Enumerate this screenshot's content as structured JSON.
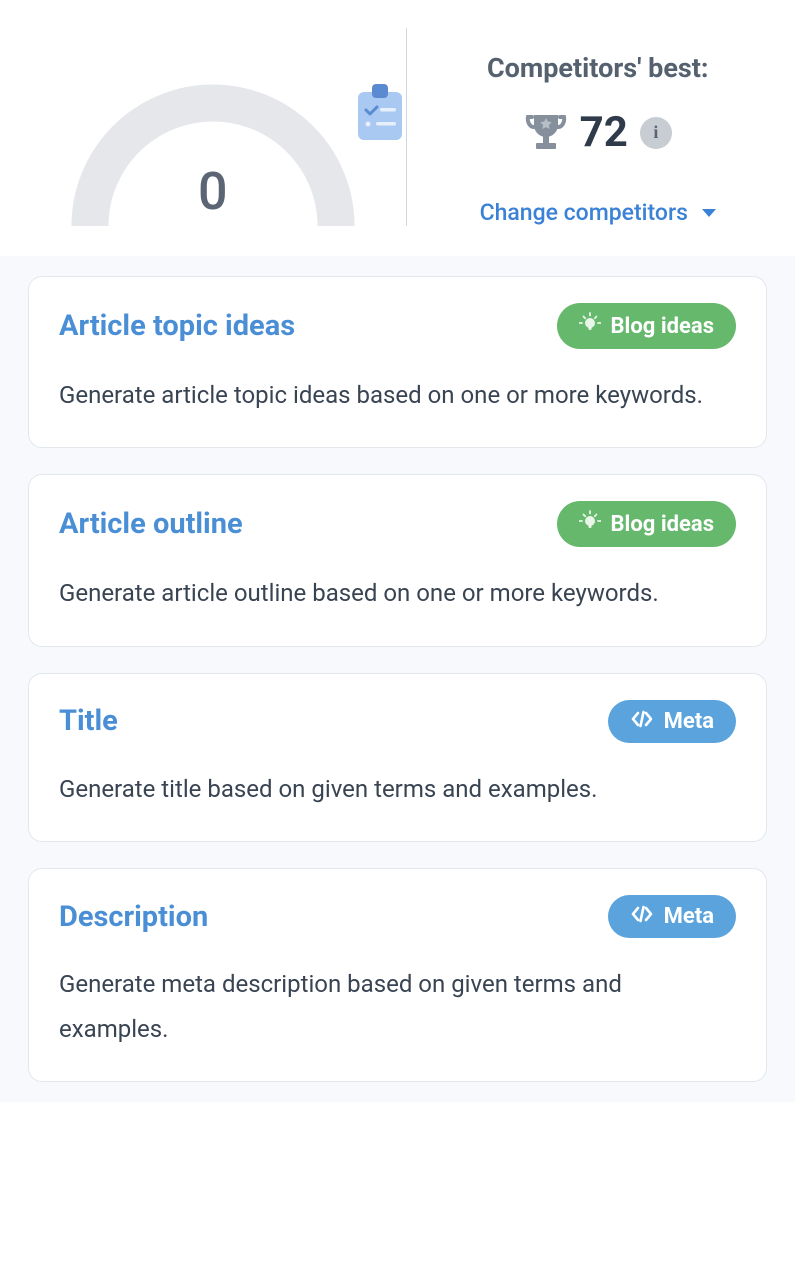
{
  "score": {
    "value": "0"
  },
  "competitors": {
    "label": "Competitors' best:",
    "score": "72",
    "change_label": "Change competitors"
  },
  "cards": [
    {
      "title": "Article topic ideas",
      "desc": "Generate article topic ideas based on one or more keywords.",
      "pill_label": "Blog ideas",
      "pill_kind": "green"
    },
    {
      "title": "Article outline",
      "desc": "Generate article outline based on one or more keywords.",
      "pill_label": "Blog ideas",
      "pill_kind": "green"
    },
    {
      "title": "Title",
      "desc": "Generate title based on given terms and examples.",
      "pill_label": "Meta",
      "pill_kind": "blue"
    },
    {
      "title": "Description",
      "desc": "Generate meta description based on given terms and examples.",
      "pill_label": "Meta",
      "pill_kind": "blue"
    }
  ]
}
